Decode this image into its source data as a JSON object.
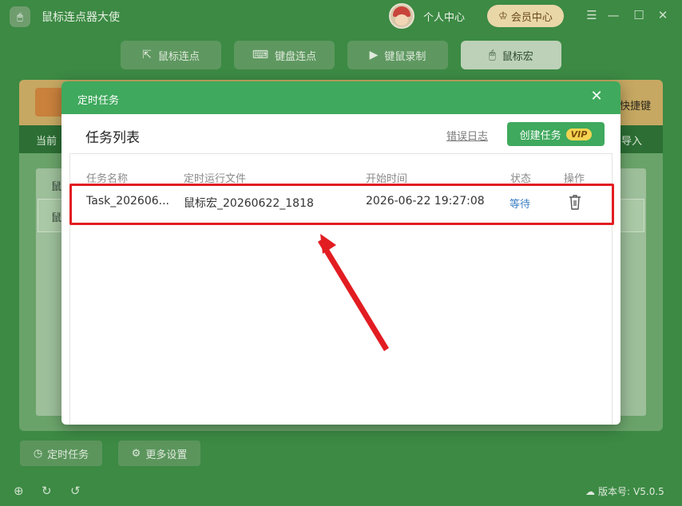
{
  "app": {
    "title": "鼠标连点器大使",
    "user_center": "个人中心",
    "vip_center": "会员中心",
    "win_controls": [
      "☰",
      "—",
      "☐",
      "✕"
    ]
  },
  "modes": [
    {
      "label": "鼠标连点",
      "icon": "cursor-icon"
    },
    {
      "label": "键盘连点",
      "icon": "keyboard-icon"
    },
    {
      "label": "键鼠录制",
      "icon": "record-icon"
    },
    {
      "label": "鼠标宏",
      "icon": "mouse-icon"
    }
  ],
  "background_panel": {
    "top_right_text": "快捷键",
    "strip_left": "当前",
    "strip_right": "导入",
    "table_row1": "鼠",
    "table_row2": "鼠"
  },
  "bottom_buttons": {
    "scheduled": "定时任务",
    "more_settings": "更多设置"
  },
  "footer": {
    "version_label": "版本号:",
    "version": "V5.0.5"
  },
  "modal": {
    "title": "定时任务",
    "list_title": "任务列表",
    "error_log": "错误日志",
    "create_button": "创建任务",
    "vip_tag": "VIP",
    "columns": [
      "任务名称",
      "定时运行文件",
      "开始时间",
      "状态",
      "操作"
    ],
    "rows": [
      {
        "name": "Task_202606...",
        "file": "鼠标宏_20260622_1818",
        "start_time": "2026-06-22 19:27:08",
        "status": "等待"
      }
    ]
  },
  "colors": {
    "modal_header": "#3fa95d",
    "highlight": "#e21d22",
    "status_link": "#3b7fc4",
    "vip_gold": "#f5d451"
  }
}
